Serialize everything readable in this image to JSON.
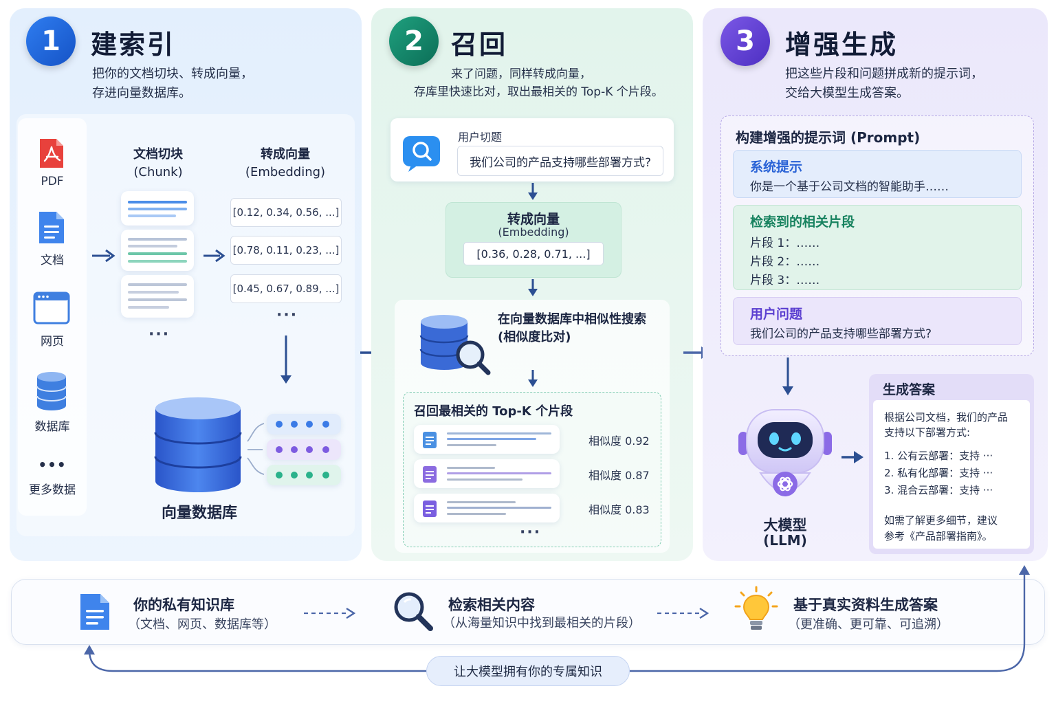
{
  "colors": {
    "blue": "#2f7df0",
    "green": "#1fa07e",
    "purple": "#6a4ae0"
  },
  "panel1": {
    "number": "1",
    "title": "建索引",
    "desc_line1": "把你的文档切块、转成向量，",
    "desc_line2": "存进向量数据库。",
    "sources": [
      {
        "label": "PDF",
        "icon": "pdf-icon"
      },
      {
        "label": "文档",
        "icon": "document-icon"
      },
      {
        "label": "网页",
        "icon": "webpage-icon"
      },
      {
        "label": "数据库",
        "icon": "database-icon"
      },
      {
        "label": "更多数据",
        "icon": "more-icon"
      }
    ],
    "more_dots": "•••",
    "chunk_head1": "文档切块",
    "chunk_head2": "(Chunk)",
    "embed_head1": "转成向量",
    "embed_head2": "(Embedding)",
    "vectors": [
      "[0.12, 0.34, 0.56, ...]",
      "[0.78, 0.11, 0.23, ...]",
      "[0.45, 0.67, 0.89, ...]"
    ],
    "chunk_ellipsis": "···",
    "vector_ellipsis": "···",
    "db_label": "向量数据库"
  },
  "panel2": {
    "number": "2",
    "title": "召回",
    "desc_line1": "来了问题，同样转成向量，",
    "desc_line2": "存库里快速比对，取出最相关的 Top-K 个片段。",
    "question_label": "用户切题",
    "question": "我们公司的产品支持哪些部署方式?",
    "embed_title": "转成向量",
    "embed_sub": "(Embedding)",
    "embed_vector": "[0.36, 0.28, 0.71, ...]",
    "search_line1": "在向量数据库中相似性搜索",
    "search_line2": "(相似度比对)",
    "topk_title": "召回最相关的 Top-K 个片段",
    "results": [
      {
        "score": "相似度 0.92",
        "color": "#4a90e2"
      },
      {
        "score": "相似度 0.87",
        "color": "#8b6be0"
      },
      {
        "score": "相似度 0.83",
        "color": "#7a5ee0"
      }
    ],
    "result_ellipsis": "···"
  },
  "panel3": {
    "number": "3",
    "title": "增强生成",
    "desc_line1": "把这些片段和问题拼成新的提示词，",
    "desc_line2": "交给大模型生成答案。",
    "prompt_title": "构建增强的提示词 (Prompt)",
    "system_title": "系统提示",
    "system_text": "你是一个基于公司文档的智能助手……",
    "retrieved_title": "检索到的相关片段",
    "retrieved_items": [
      "片段 1：……",
      "片段 2：……",
      "片段 3：……"
    ],
    "question_title": "用户问题",
    "question_text": "我们公司的产品支持哪些部署方式?",
    "llm_label1": "大模型",
    "llm_label2": "(LLM)",
    "answer_title": "生成答案",
    "answer_intro1": "根据公司文档，我们的产品",
    "answer_intro2": "支持以下部署方式:",
    "answer_items": [
      "1. 公有云部署：支持 ···",
      "2. 私有化部署：支持 ···",
      "3. 混合云部署：支持 ···"
    ],
    "answer_outro1": "如需了解更多细节，建议",
    "answer_outro2": "参考《产品部署指南》。"
  },
  "bottom": {
    "items": [
      {
        "title": "你的私有知识库",
        "sub": "（文档、网页、数据库等）"
      },
      {
        "title": "检索相关内容",
        "sub": "（从海量知识中找到最相关的片段）"
      },
      {
        "title": "基于真实资料生成答案",
        "sub": "（更准确、更可靠、可追溯）"
      }
    ],
    "loop_label": "让大模型拥有你的专属知识"
  }
}
